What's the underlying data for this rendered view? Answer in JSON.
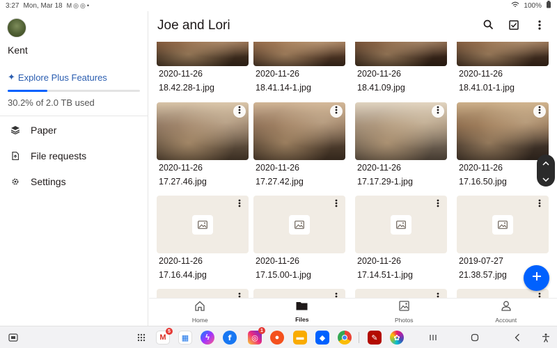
{
  "status_bar": {
    "time": "3:27",
    "date": "Mon, Mar 18",
    "notif_icons": [
      "gmail-icon",
      "instagram-icon",
      "instagram-icon",
      "dot"
    ],
    "battery": "100%"
  },
  "sidebar": {
    "username": "Kent",
    "explore_label": "Explore Plus Features",
    "usage_text": "30.2% of 2.0 TB used",
    "usage_fraction": 0.302,
    "items": [
      {
        "label": "Paper",
        "icon": "paper-icon"
      },
      {
        "label": "File requests",
        "icon": "file-request-icon"
      },
      {
        "label": "Settings",
        "icon": "gear-icon"
      }
    ]
  },
  "header": {
    "title": "Joe and Lori",
    "actions": [
      "search-icon",
      "select-checkbox-icon",
      "more-vert-icon"
    ]
  },
  "files": [
    {
      "date": "2020-11-26",
      "name": "18.42.28-1.jpg",
      "thumb": "photo"
    },
    {
      "date": "2020-11-26",
      "name": "18.41.14-1.jpg",
      "thumb": "photo"
    },
    {
      "date": "2020-11-26",
      "name": "18.41.09.jpg",
      "thumb": "photo"
    },
    {
      "date": "2020-11-26",
      "name": "18.41.01-1.jpg",
      "thumb": "photo"
    },
    {
      "date": "2020-11-26",
      "name": "17.27.46.jpg",
      "thumb": "photo"
    },
    {
      "date": "2020-11-26",
      "name": "17.27.42.jpg",
      "thumb": "photo"
    },
    {
      "date": "2020-11-26",
      "name": "17.17.29-1.jpg",
      "thumb": "photo"
    },
    {
      "date": "2020-11-26",
      "name": "17.16.50.jpg",
      "thumb": "photo"
    },
    {
      "date": "2020-11-26",
      "name": "17.16.44.jpg",
      "thumb": "placeholder"
    },
    {
      "date": "2020-11-26",
      "name": "17.15.00-1.jpg",
      "thumb": "placeholder"
    },
    {
      "date": "2020-11-26",
      "name": "17.14.51-1.jpg",
      "thumb": "placeholder"
    },
    {
      "date": "2019-07-27",
      "name": "21.38.57.jpg",
      "thumb": "placeholder"
    }
  ],
  "bottom_nav": [
    {
      "label": "Home",
      "icon": "home-icon",
      "active": false
    },
    {
      "label": "Files",
      "icon": "folder-icon",
      "active": true
    },
    {
      "label": "Photos",
      "icon": "photos-icon",
      "active": false
    },
    {
      "label": "Account",
      "icon": "account-icon",
      "active": false
    }
  ],
  "taskbar": {
    "apps": [
      {
        "name": "gmail",
        "badge": "5"
      },
      {
        "name": "google-calendar",
        "badge": ""
      },
      {
        "name": "messenger",
        "badge": ""
      },
      {
        "name": "facebook",
        "badge": ""
      },
      {
        "name": "instagram",
        "badge": "1"
      },
      {
        "name": "contacts",
        "badge": ""
      },
      {
        "name": "my-files",
        "badge": ""
      },
      {
        "name": "dropbox",
        "badge": ""
      },
      {
        "name": "chrome",
        "badge": ""
      },
      {
        "name": "adobe-acrobat",
        "badge": ""
      },
      {
        "name": "gallery",
        "badge": ""
      }
    ]
  },
  "colors": {
    "accent": "#0061fe",
    "placeholder_bg": "#f1ece4",
    "text": "#1e1919"
  }
}
